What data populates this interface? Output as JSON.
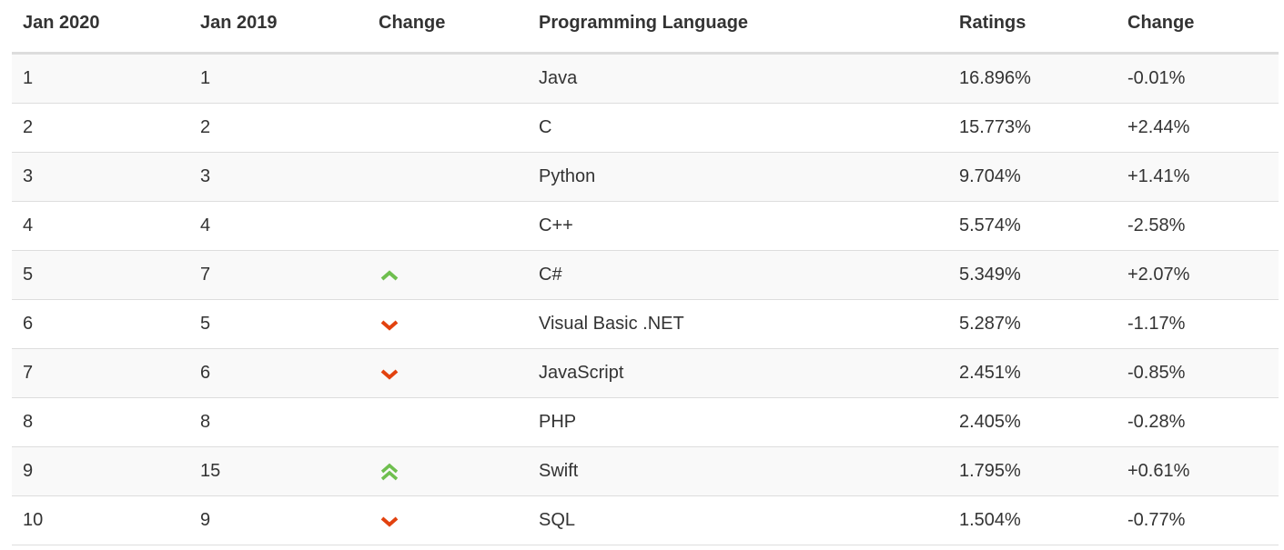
{
  "table": {
    "headers": [
      "Jan 2020",
      "Jan 2019",
      "Change",
      "Programming Language",
      "Ratings",
      "Change"
    ],
    "rows": [
      {
        "jan2020": "1",
        "jan2019": "1",
        "trend": "none",
        "language": "Java",
        "ratings": "16.896%",
        "change": "-0.01%"
      },
      {
        "jan2020": "2",
        "jan2019": "2",
        "trend": "none",
        "language": "C",
        "ratings": "15.773%",
        "change": "+2.44%"
      },
      {
        "jan2020": "3",
        "jan2019": "3",
        "trend": "none",
        "language": "Python",
        "ratings": "9.704%",
        "change": "+1.41%"
      },
      {
        "jan2020": "4",
        "jan2019": "4",
        "trend": "none",
        "language": "C++",
        "ratings": "5.574%",
        "change": "-2.58%"
      },
      {
        "jan2020": "5",
        "jan2019": "7",
        "trend": "up",
        "language": "C#",
        "ratings": "5.349%",
        "change": "+2.07%"
      },
      {
        "jan2020": "6",
        "jan2019": "5",
        "trend": "down",
        "language": "Visual Basic .NET",
        "ratings": "5.287%",
        "change": "-1.17%"
      },
      {
        "jan2020": "7",
        "jan2019": "6",
        "trend": "down",
        "language": "JavaScript",
        "ratings": "2.451%",
        "change": "-0.85%"
      },
      {
        "jan2020": "8",
        "jan2019": "8",
        "trend": "none",
        "language": "PHP",
        "ratings": "2.405%",
        "change": "-0.28%"
      },
      {
        "jan2020": "9",
        "jan2019": "15",
        "trend": "double-up",
        "language": "Swift",
        "ratings": "1.795%",
        "change": "+0.61%"
      },
      {
        "jan2020": "10",
        "jan2019": "9",
        "trend": "down",
        "language": "SQL",
        "ratings": "1.504%",
        "change": "-0.77%"
      }
    ]
  },
  "icons": {
    "up": "chevron-up-icon",
    "double-up": "double-chevron-up-icon",
    "down": "chevron-down-icon"
  },
  "colors": {
    "up": "#6fbf4f",
    "down": "#e2420f",
    "row_stripe": "#f9f9f9",
    "border": "#dddddd",
    "text": "#333333"
  }
}
